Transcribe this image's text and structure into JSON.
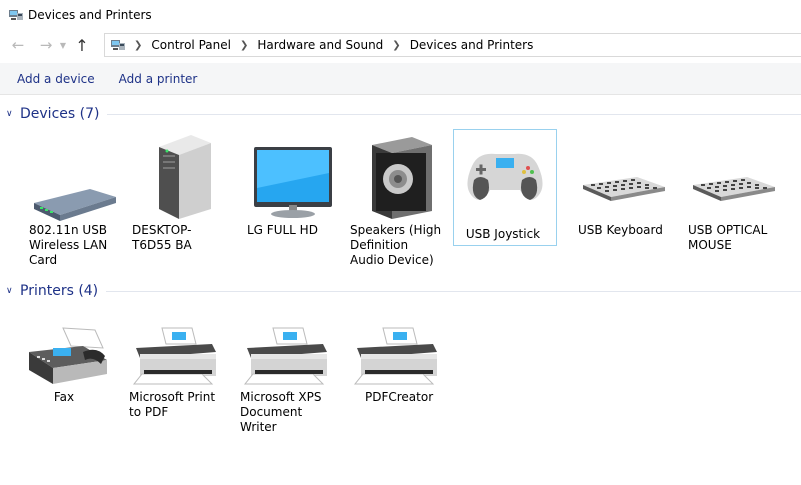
{
  "window": {
    "title": "Devices and Printers"
  },
  "address": {
    "crumbs": [
      "Control Panel",
      "Hardware and Sound",
      "Devices and Printers"
    ]
  },
  "commands": {
    "add_device": "Add a device",
    "add_printer": "Add a printer"
  },
  "groups": {
    "devices": {
      "title": "Devices (7)"
    },
    "printers": {
      "title": "Printers (4)"
    }
  },
  "devices": [
    {
      "label": "802.11n USB Wireless LAN Card",
      "icon": "usb-wifi-adapter-icon"
    },
    {
      "label": "DESKTOP-T6D55 BA",
      "icon": "desktop-tower-icon"
    },
    {
      "label": "LG FULL HD",
      "icon": "monitor-icon"
    },
    {
      "label": "Speakers (High Definition Audio Device)",
      "icon": "speaker-icon"
    },
    {
      "label": "USB Joystick",
      "icon": "gamepad-icon"
    },
    {
      "label": "USB Keyboard",
      "icon": "keyboard-icon"
    },
    {
      "label": "USB OPTICAL MOUSE",
      "icon": "keyboard-icon"
    }
  ],
  "printers": [
    {
      "label": "Fax",
      "icon": "fax-icon"
    },
    {
      "label": "Microsoft Print to PDF",
      "icon": "printer-icon"
    },
    {
      "label": "Microsoft XPS Document Writer",
      "icon": "printer-icon"
    },
    {
      "label": "PDFCreator",
      "icon": "printer-icon"
    }
  ],
  "colors": {
    "link": "#1e3287",
    "selection_border": "#99d1ee",
    "command_bg": "#f5f6f7"
  }
}
